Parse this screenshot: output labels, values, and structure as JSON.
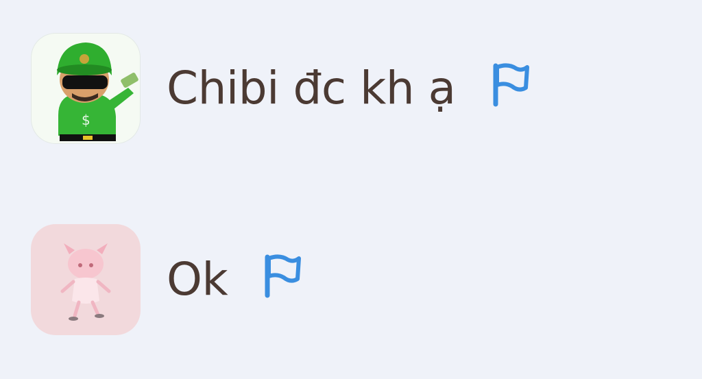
{
  "messages": [
    {
      "text": "Chibi đc kh ạ",
      "avatar": "green-chibi-avatar",
      "icon": "flag-icon"
    },
    {
      "text": "Ok",
      "avatar": "pink-chibi-avatar",
      "icon": "flag-icon"
    }
  ],
  "colors": {
    "background": "#eff2f9",
    "text": "#4b3a33",
    "flag": "#3a8ee0"
  }
}
